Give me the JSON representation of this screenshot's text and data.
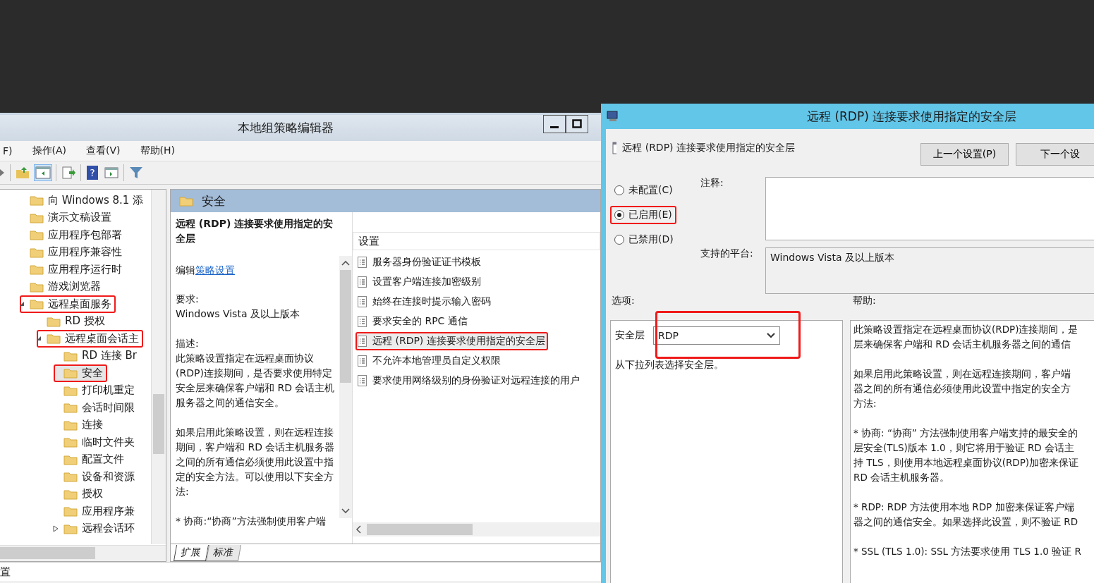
{
  "window": {
    "title": "本地组策略编辑器"
  },
  "menu": [
    "F)",
    "操作(A)",
    "查看(V)",
    "帮助(H)"
  ],
  "toolbar": {
    "help_glyph": "?"
  },
  "tree": {
    "items": [
      {
        "label": "向 Windows 8.1 添",
        "selected": false,
        "annotated": false
      },
      {
        "label": "演示文稿设置",
        "selected": false,
        "annotated": false
      },
      {
        "label": "应用程序包部署",
        "selected": false,
        "annotated": false
      },
      {
        "label": "应用程序兼容性",
        "selected": false,
        "annotated": false
      },
      {
        "label": "应用程序运行时",
        "selected": false,
        "annotated": false
      },
      {
        "label": "游戏浏览器",
        "selected": false,
        "annotated": false
      },
      {
        "label": "远程桌面服务",
        "selected": false,
        "annotated": true,
        "expanded": true,
        "children": [
          {
            "label": "RD 授权",
            "selected": false,
            "annotated": false
          },
          {
            "label": "远程桌面会话主",
            "selected": false,
            "annotated": true,
            "expanded": true,
            "children": [
              {
                "label": "RD 连接 Br",
                "selected": false,
                "annotated": false
              },
              {
                "label": "安全",
                "selected": true,
                "annotated": true
              },
              {
                "label": "打印机重定",
                "selected": false,
                "annotated": false
              },
              {
                "label": "会话时间限",
                "selected": false,
                "annotated": false
              },
              {
                "label": "连接",
                "selected": false,
                "annotated": false
              },
              {
                "label": "临时文件夹",
                "selected": false,
                "annotated": false
              },
              {
                "label": "配置文件",
                "selected": false,
                "annotated": false
              },
              {
                "label": "设备和资源",
                "selected": false,
                "annotated": false
              },
              {
                "label": "授权",
                "selected": false,
                "annotated": false
              },
              {
                "label": "应用程序兼",
                "selected": false,
                "annotated": false
              },
              {
                "label": "远程会话环",
                "selected": false,
                "annotated": false,
                "expanded": false
              }
            ]
          }
        ]
      }
    ]
  },
  "details": {
    "header": "安全",
    "title": "远程 (RDP) 连接要求使用指定的安全层",
    "edit_prefix": "编辑",
    "edit_link": "策略设置",
    "requirement_label": "要求:",
    "requirement": "Windows Vista 及以上版本",
    "description_label": "描述:",
    "paragraphs": [
      "此策略设置指定在远程桌面协议(RDP)连接期间，是否要求使用特定安全层来确保客户端和 RD 会话主机服务器之间的通信安全。",
      "如果启用此策略设置，则在远程连接期间，客户端和 RD 会话主机服务器之间的所有通信必须使用此设置中指定的安全方法。可以使用以下安全方法:"
    ],
    "cut_line": "* 协商:“协商”方法强制使用客户端"
  },
  "settings": {
    "column": "设置",
    "items": [
      {
        "label": "服务器身份验证证书模板",
        "selected": false,
        "annotated": false
      },
      {
        "label": "设置客户端连接加密级别",
        "selected": false,
        "annotated": false
      },
      {
        "label": "始终在连接时提示输入密码",
        "selected": false,
        "annotated": false
      },
      {
        "label": "要求安全的 RPC 通信",
        "selected": false,
        "annotated": false
      },
      {
        "label": "远程 (RDP) 连接要求使用指定的安全层",
        "selected": true,
        "annotated": true
      },
      {
        "label": "不允许本地管理员自定义权限",
        "selected": false,
        "annotated": false
      },
      {
        "label": "要求使用网络级别的身份验证对远程连接的用户",
        "selected": false,
        "annotated": false
      }
    ]
  },
  "view_tabs": [
    {
      "label": "扩展",
      "selected": true
    },
    {
      "label": "标准",
      "selected": false
    }
  ],
  "status_bar": "置",
  "dialog": {
    "title": "远程 (RDP) 连接要求使用指定的安全层",
    "heading": "远程 (RDP) 连接要求使用指定的安全层",
    "buttons": [
      "上一个设置(P)",
      "下一个设"
    ],
    "radios": [
      {
        "label": "未配置(C)",
        "selected": false,
        "annotated": false
      },
      {
        "label": "已启用(E)",
        "selected": true,
        "annotated": true
      },
      {
        "label": "已禁用(D)",
        "selected": false,
        "annotated": false
      }
    ],
    "comment_label": "注释:",
    "platform_label": "支持的平台:",
    "platform": "Windows Vista 及以上版本",
    "options_label": "选项:",
    "help_label": "帮助:",
    "options": {
      "annotated": true,
      "field_label": "安全层",
      "value": "RDP",
      "hint": "从下拉列表选择安全层。"
    },
    "help": [
      [
        "此策略设置指定在远程桌面协议(RDP)连接期间，是",
        "层来确保客户端和 RD 会话主机服务器之间的通信"
      ],
      [
        "如果启用此策略设置，则在远程连接期间，客户端",
        "器之间的所有通信必须使用此设置中指定的安全方",
        "方法:"
      ],
      [
        "* 协商: “协商” 方法强制使用客户端支持的最安全的",
        "层安全(TLS)版本 1.0，则它将用于验证 RD 会话主",
        "持 TLS，则使用本地远程桌面协议(RDP)加密来保证",
        "RD 会话主机服务器。"
      ],
      [
        "* RDP: RDP 方法使用本地 RDP 加密来保证客户端",
        "器之间的通信安全。如果选择此设置，则不验证 RD"
      ],
      [
        "* SSL (TLS 1.0): SSL 方法要求使用 TLS 1.0 验证 R"
      ]
    ]
  }
}
